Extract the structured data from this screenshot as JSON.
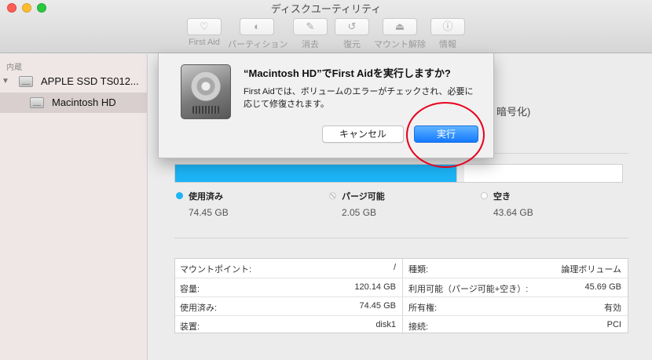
{
  "window": {
    "title": "ディスクユーティリティ"
  },
  "toolbar": [
    {
      "label": "First Aid",
      "icon": "stethoscope-icon",
      "glyph": "♡"
    },
    {
      "label": "パーティション",
      "icon": "partition-icon",
      "glyph": "◐"
    },
    {
      "label": "消去",
      "icon": "erase-icon",
      "glyph": "✎"
    },
    {
      "label": "復元",
      "icon": "restore-icon",
      "glyph": "↺"
    },
    {
      "label": "マウント解除",
      "icon": "unmount-icon",
      "glyph": "⏏"
    },
    {
      "label": "情報",
      "icon": "info-icon",
      "glyph": "ⓘ"
    }
  ],
  "sidebar": {
    "section": "内蔵",
    "disk": "APPLE SSD TS012...",
    "volume": "Macintosh HD"
  },
  "main": {
    "info_tail": "、暗号化)",
    "usage": {
      "used_fraction": 0.6295,
      "purgeable_fraction": 0.0173,
      "colors": {
        "used": "#1cb4f6",
        "purgeable": "#ececec",
        "free": "#ffffff"
      },
      "used": {
        "label": "使用済み",
        "value": "74.45 GB"
      },
      "purgeable": {
        "label": "パージ可能",
        "value": "2.05 GB"
      },
      "free": {
        "label": "空き",
        "value": "43.64 GB"
      }
    },
    "table": {
      "left": [
        {
          "label": "マウントポイント:",
          "value": "/"
        },
        {
          "label": "容量:",
          "value": "120.14 GB"
        },
        {
          "label": "使用済み:",
          "value": "74.45 GB"
        },
        {
          "label": "装置:",
          "value": "disk1"
        }
      ],
      "right": [
        {
          "label": "種類:",
          "value": "論理ボリューム"
        },
        {
          "label": "利用可能（パージ可能+空き）:",
          "value": "45.69 GB"
        },
        {
          "label": "所有権:",
          "value": "有効"
        },
        {
          "label": "接続:",
          "value": "PCI"
        }
      ]
    }
  },
  "dialog": {
    "title": "“Macintosh HD”でFirst Aidを実行しますか?",
    "message": "First Aidでは、ボリュームのエラーがチェックされ、必要に応じて修復されます。",
    "cancel": "キャンセル",
    "run": "実行"
  }
}
